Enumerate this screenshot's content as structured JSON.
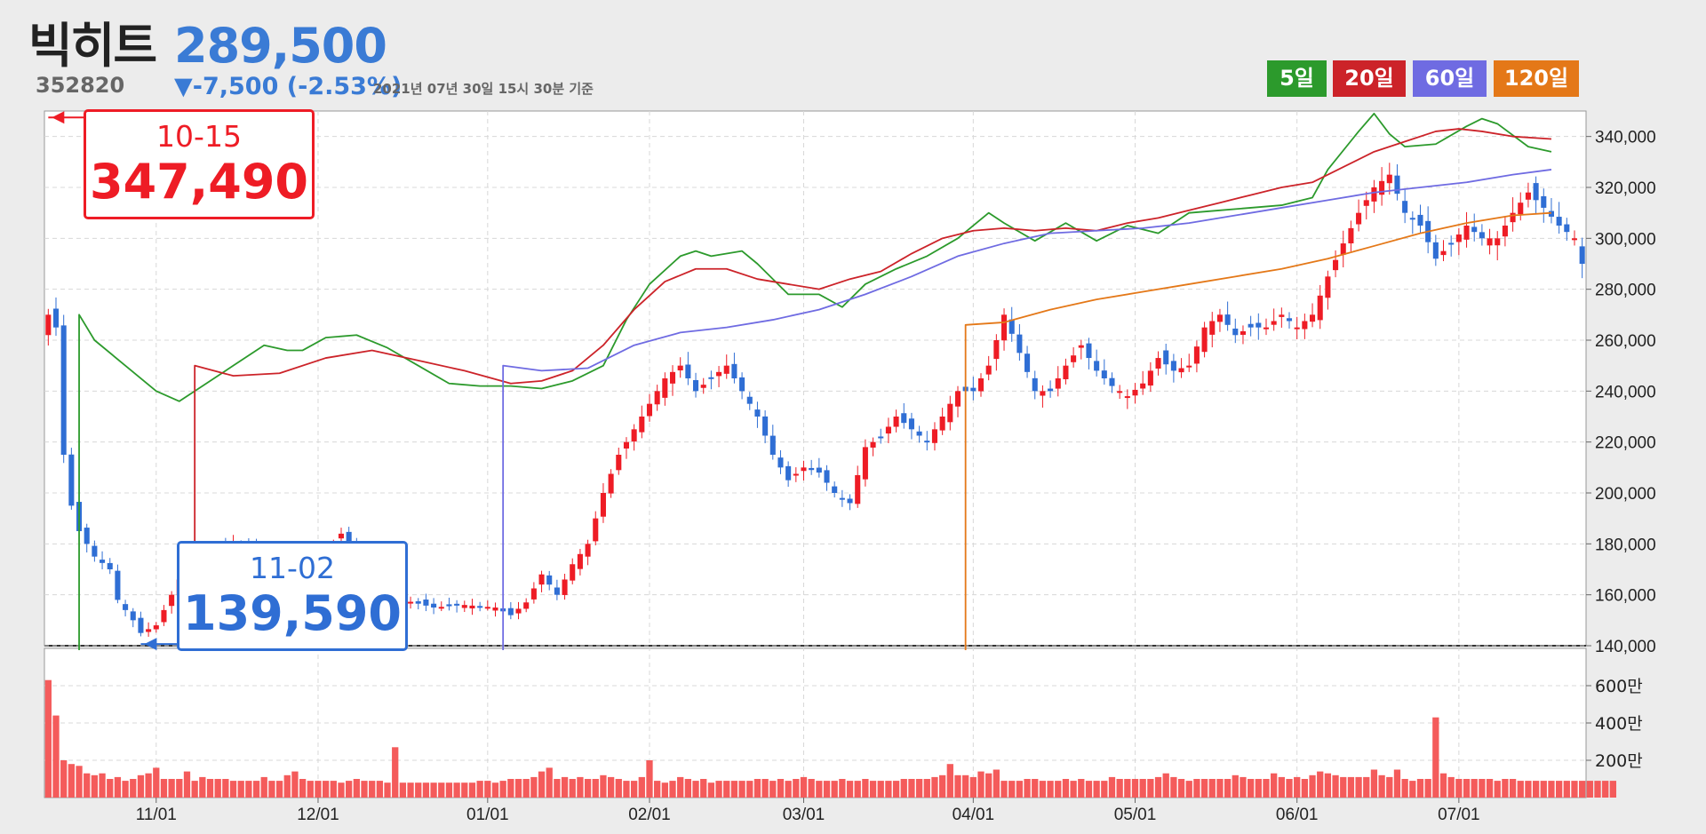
{
  "header": {
    "name": "빅히트",
    "code": "352820",
    "price": "289,500",
    "change": "▼-7,500 (-2.53%)",
    "timestamp": "2021년 07년 30일 15시 30분 기준"
  },
  "ma_buttons": [
    {
      "label": "5일",
      "color": "#2c9a2c"
    },
    {
      "label": "20일",
      "color": "#cc2329"
    },
    {
      "label": "60일",
      "color": "#6f6be2"
    },
    {
      "label": "120일",
      "color": "#e47818"
    }
  ],
  "annotations": {
    "high": {
      "date": "10-15",
      "value": "347,490",
      "color": "#ee1c25"
    },
    "low": {
      "date": "11-02",
      "value": "139,590",
      "color": "#2f6ed4"
    }
  },
  "chart_data": {
    "type": "candlestick",
    "price_ylim": [
      140000,
      350000
    ],
    "price_ticks": [
      "340,000",
      "320,000",
      "300,000",
      "280,000",
      "260,000",
      "240,000",
      "220,000",
      "200,000",
      "180,000",
      "160,000",
      "140,000"
    ],
    "volume_ticks": [
      "600만",
      "400만",
      "200만"
    ],
    "volume_tick_values": [
      6000000,
      4000000,
      2000000
    ],
    "volume_ylim": [
      0,
      8000000
    ],
    "x_ticks": [
      "11/01",
      "12/01",
      "01/01",
      "02/01",
      "03/01",
      "04/01",
      "05/01",
      "06/01",
      "07/01"
    ],
    "x_tick_positions": [
      14,
      35,
      57,
      78,
      98,
      120,
      141,
      162,
      183
    ],
    "n_days": 200,
    "price_anchors": [
      [
        0,
        270000
      ],
      [
        1,
        265000
      ],
      [
        2,
        215000
      ],
      [
        3,
        195000
      ],
      [
        4,
        185000
      ],
      [
        6,
        175000
      ],
      [
        8,
        170000
      ],
      [
        9,
        158000
      ],
      [
        11,
        150000
      ],
      [
        12,
        145000
      ],
      [
        14,
        148000
      ],
      [
        16,
        160000
      ],
      [
        18,
        172000
      ],
      [
        20,
        178000
      ],
      [
        24,
        180000
      ],
      [
        28,
        176000
      ],
      [
        32,
        174000
      ],
      [
        36,
        176000
      ],
      [
        38,
        184000
      ],
      [
        40,
        175000
      ],
      [
        42,
        165000
      ],
      [
        46,
        158000
      ],
      [
        50,
        155000
      ],
      [
        54,
        156000
      ],
      [
        58,
        155000
      ],
      [
        60,
        152000
      ],
      [
        62,
        157000
      ],
      [
        64,
        168000
      ],
      [
        66,
        160000
      ],
      [
        68,
        172000
      ],
      [
        70,
        180000
      ],
      [
        72,
        200000
      ],
      [
        74,
        215000
      ],
      [
        76,
        225000
      ],
      [
        78,
        235000
      ],
      [
        80,
        245000
      ],
      [
        82,
        250000
      ],
      [
        84,
        240000
      ],
      [
        86,
        245000
      ],
      [
        88,
        250000
      ],
      [
        90,
        240000
      ],
      [
        92,
        230000
      ],
      [
        94,
        215000
      ],
      [
        96,
        205000
      ],
      [
        98,
        210000
      ],
      [
        100,
        208000
      ],
      [
        102,
        200000
      ],
      [
        104,
        196000
      ],
      [
        106,
        218000
      ],
      [
        108,
        222000
      ],
      [
        110,
        230000
      ],
      [
        112,
        225000
      ],
      [
        114,
        220000
      ],
      [
        116,
        230000
      ],
      [
        118,
        240000
      ],
      [
        120,
        240000
      ],
      [
        122,
        250000
      ],
      [
        124,
        270000
      ],
      [
        126,
        255000
      ],
      [
        128,
        240000
      ],
      [
        130,
        240000
      ],
      [
        132,
        250000
      ],
      [
        134,
        258000
      ],
      [
        136,
        248000
      ],
      [
        138,
        242000
      ],
      [
        140,
        238000
      ],
      [
        142,
        243000
      ],
      [
        144,
        253000
      ],
      [
        146,
        248000
      ],
      [
        148,
        250000
      ],
      [
        150,
        265000
      ],
      [
        152,
        270000
      ],
      [
        154,
        262000
      ],
      [
        156,
        265000
      ],
      [
        158,
        265000
      ],
      [
        160,
        270000
      ],
      [
        162,
        265000
      ],
      [
        164,
        270000
      ],
      [
        166,
        285000
      ],
      [
        168,
        298000
      ],
      [
        170,
        310000
      ],
      [
        172,
        320000
      ],
      [
        174,
        325000
      ],
      [
        176,
        310000
      ],
      [
        178,
        305000
      ],
      [
        180,
        292000
      ],
      [
        182,
        298000
      ],
      [
        184,
        305000
      ],
      [
        186,
        300000
      ],
      [
        188,
        300000
      ],
      [
        190,
        310000
      ],
      [
        192,
        318000
      ],
      [
        194,
        312000
      ],
      [
        196,
        305000
      ],
      [
        198,
        300000
      ],
      [
        199,
        290000
      ]
    ],
    "volumes": [
      6.3,
      4.4,
      2.0,
      1.8,
      1.7,
      1.3,
      1.2,
      1.3,
      1.0,
      1.1,
      0.9,
      1.0,
      1.2,
      1.3,
      1.6,
      1.0,
      1.0,
      1.0,
      1.4,
      0.9,
      1.1,
      1.0,
      1.0,
      1.0,
      0.9,
      0.9,
      0.9,
      0.9,
      1.1,
      0.9,
      0.9,
      1.2,
      1.4,
      1.0,
      0.9,
      0.9,
      0.9,
      0.9,
      0.8,
      0.9,
      1.0,
      0.9,
      0.9,
      0.9,
      0.8,
      2.7,
      0.8,
      0.8,
      0.8,
      0.8,
      0.8,
      0.8,
      0.8,
      0.8,
      0.8,
      0.8,
      0.9,
      0.9,
      0.8,
      0.9,
      1.0,
      1.0,
      1.0,
      1.1,
      1.4,
      1.6,
      1.0,
      1.1,
      1.0,
      1.1,
      1.0,
      1.0,
      1.2,
      1.1,
      1.0,
      0.9,
      0.9,
      1.1,
      2.0,
      0.9,
      0.8,
      0.9,
      1.1,
      1.0,
      0.9,
      1.0,
      0.8,
      0.9,
      0.9,
      0.9,
      0.9,
      0.9,
      1.0,
      1.0,
      0.9,
      1.0,
      0.9,
      1.0,
      1.1,
      1.0,
      0.9,
      0.9,
      0.9,
      1.0,
      0.9,
      0.9,
      1.0,
      0.9,
      0.9,
      0.9,
      0.9,
      1.0,
      1.0,
      1.0,
      1.0,
      1.1,
      1.2,
      1.8,
      1.2,
      1.2,
      1.1,
      1.4,
      1.3,
      1.5,
      0.9,
      0.9,
      0.9,
      1.0,
      1.0,
      0.9,
      0.9,
      0.9,
      1.0,
      0.9,
      1.0,
      0.9,
      0.9,
      0.9,
      1.1,
      1.0,
      1.0,
      1.0,
      1.0,
      1.0,
      1.1,
      1.3,
      1.1,
      1.0,
      0.9,
      1.0,
      1.0,
      1.0,
      1.0,
      1.0,
      1.2,
      1.1,
      1.0,
      1.0,
      1.0,
      1.3,
      1.1,
      1.0,
      1.1,
      1.0,
      1.2,
      1.4,
      1.3,
      1.2,
      1.1,
      1.1,
      1.1,
      1.1,
      1.5,
      1.2,
      1.1,
      1.5,
      1.0,
      0.9,
      1.0,
      1.0,
      4.3,
      1.3,
      1.1,
      1.0,
      1.0,
      1.0,
      1.0,
      1.0,
      0.9,
      1.0,
      1.0,
      0.9,
      0.9,
      0.9,
      0.9,
      0.9,
      0.9,
      0.9,
      0.9,
      0.9,
      0.9,
      0.9,
      0.9,
      0.9
    ],
    "ma5": [
      [
        4,
        270000
      ],
      [
        6,
        260000
      ],
      [
        10,
        250000
      ],
      [
        14,
        240000
      ],
      [
        17,
        236000
      ],
      [
        20,
        242000
      ],
      [
        24,
        250000
      ],
      [
        28,
        258000
      ],
      [
        31,
        256000
      ],
      [
        33,
        256000
      ],
      [
        36,
        261000
      ],
      [
        40,
        262000
      ],
      [
        44,
        257000
      ],
      [
        48,
        250000
      ],
      [
        52,
        243000
      ],
      [
        56,
        242000
      ],
      [
        60,
        242000
      ],
      [
        64,
        241000
      ],
      [
        68,
        244000
      ],
      [
        72,
        250000
      ],
      [
        75,
        268000
      ],
      [
        78,
        282000
      ],
      [
        82,
        293000
      ],
      [
        84,
        295000
      ],
      [
        86,
        293000
      ],
      [
        90,
        295000
      ],
      [
        92,
        290000
      ],
      [
        96,
        278000
      ],
      [
        100,
        278000
      ],
      [
        103,
        273000
      ],
      [
        106,
        282000
      ],
      [
        110,
        288000
      ],
      [
        114,
        293000
      ],
      [
        118,
        300000
      ],
      [
        122,
        310000
      ],
      [
        124,
        306000
      ],
      [
        128,
        299000
      ],
      [
        132,
        306000
      ],
      [
        136,
        299000
      ],
      [
        140,
        305000
      ],
      [
        144,
        302000
      ],
      [
        148,
        310000
      ],
      [
        152,
        311000
      ],
      [
        156,
        312000
      ],
      [
        160,
        313000
      ],
      [
        164,
        316000
      ],
      [
        166,
        327000
      ],
      [
        170,
        342000
      ],
      [
        172,
        349000
      ],
      [
        174,
        341000
      ],
      [
        176,
        336000
      ],
      [
        180,
        337000
      ],
      [
        184,
        344000
      ],
      [
        186,
        347000
      ],
      [
        188,
        345000
      ],
      [
        192,
        336000
      ],
      [
        195,
        334000
      ]
    ],
    "ma20": [
      [
        19,
        250000
      ],
      [
        24,
        246000
      ],
      [
        30,
        247000
      ],
      [
        36,
        253000
      ],
      [
        42,
        256000
      ],
      [
        48,
        252000
      ],
      [
        54,
        248000
      ],
      [
        60,
        243000
      ],
      [
        64,
        244000
      ],
      [
        68,
        248000
      ],
      [
        72,
        258000
      ],
      [
        76,
        272000
      ],
      [
        80,
        283000
      ],
      [
        84,
        288000
      ],
      [
        88,
        288000
      ],
      [
        92,
        284000
      ],
      [
        96,
        282000
      ],
      [
        100,
        280000
      ],
      [
        104,
        284000
      ],
      [
        108,
        287000
      ],
      [
        112,
        294000
      ],
      [
        116,
        300000
      ],
      [
        120,
        303000
      ],
      [
        124,
        304000
      ],
      [
        128,
        303000
      ],
      [
        132,
        304000
      ],
      [
        136,
        303000
      ],
      [
        140,
        306000
      ],
      [
        144,
        308000
      ],
      [
        148,
        311000
      ],
      [
        152,
        314000
      ],
      [
        156,
        317000
      ],
      [
        160,
        320000
      ],
      [
        164,
        322000
      ],
      [
        168,
        328000
      ],
      [
        172,
        334000
      ],
      [
        176,
        338000
      ],
      [
        180,
        342000
      ],
      [
        183,
        343000
      ],
      [
        186,
        342000
      ],
      [
        190,
        340000
      ],
      [
        195,
        339000
      ]
    ],
    "ma60": [
      [
        59,
        250000
      ],
      [
        64,
        248000
      ],
      [
        70,
        249000
      ],
      [
        76,
        258000
      ],
      [
        82,
        263000
      ],
      [
        88,
        265000
      ],
      [
        94,
        268000
      ],
      [
        100,
        272000
      ],
      [
        106,
        278000
      ],
      [
        112,
        285000
      ],
      [
        118,
        293000
      ],
      [
        124,
        298000
      ],
      [
        130,
        302000
      ],
      [
        136,
        303000
      ],
      [
        142,
        304000
      ],
      [
        148,
        306000
      ],
      [
        154,
        309000
      ],
      [
        160,
        312000
      ],
      [
        166,
        315000
      ],
      [
        172,
        318000
      ],
      [
        178,
        320000
      ],
      [
        184,
        322000
      ],
      [
        190,
        325000
      ],
      [
        195,
        327000
      ]
    ],
    "ma120": [
      [
        119,
        266000
      ],
      [
        124,
        267000
      ],
      [
        130,
        272000
      ],
      [
        136,
        276000
      ],
      [
        142,
        279000
      ],
      [
        148,
        282000
      ],
      [
        154,
        285000
      ],
      [
        160,
        288000
      ],
      [
        166,
        292000
      ],
      [
        172,
        297000
      ],
      [
        178,
        302000
      ],
      [
        184,
        306000
      ],
      [
        190,
        309000
      ],
      [
        195,
        310000
      ]
    ],
    "series": [
      {
        "name": "5일",
        "color": "#2c9a2c"
      },
      {
        "name": "20일",
        "color": "#cc2329"
      },
      {
        "name": "60일",
        "color": "#6f6be2"
      },
      {
        "name": "120일",
        "color": "#e47818"
      }
    ],
    "up_color": "#ee1c25",
    "down_color": "#2f6ed4",
    "volume_color": "#f45b5b",
    "grid": true
  }
}
